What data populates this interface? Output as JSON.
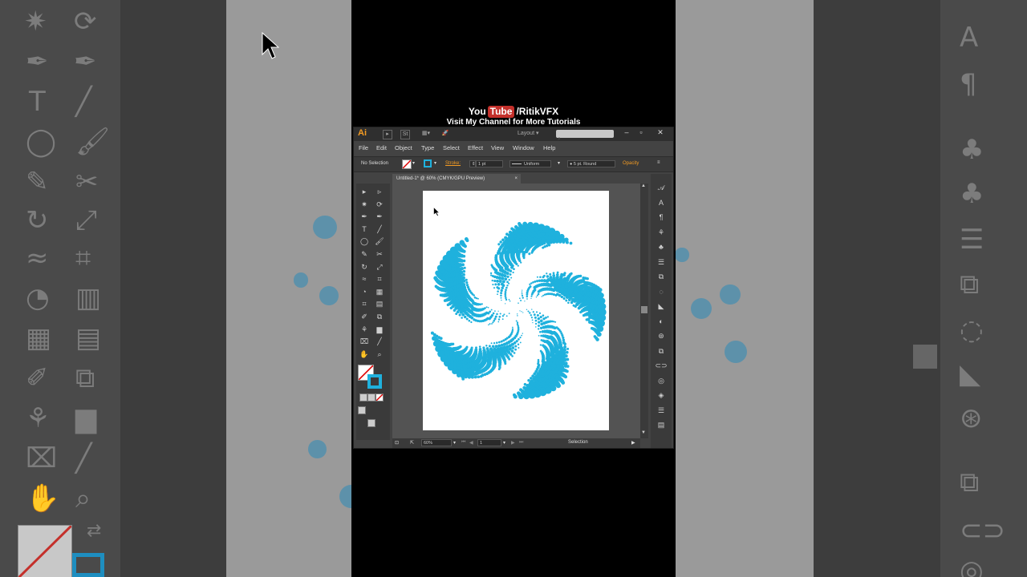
{
  "overlay": {
    "youtube_prefix": "You",
    "youtube_logo": "Tube",
    "channel": "/RitikVFX",
    "tagline": "Visit My Channel for More Tutorials"
  },
  "app": {
    "logo": "Ai",
    "workspace_label": "Layout",
    "menu": [
      "File",
      "Edit",
      "Object",
      "Type",
      "Select",
      "Effect",
      "View",
      "Window",
      "Help"
    ],
    "control_bar": {
      "selection_label": "No Selection",
      "stroke_label": "Stroke:",
      "stroke_value": "1 pt",
      "profile_value": "Uniform",
      "brush_value": "5 pt. Round",
      "opacity_label": "Opacity"
    },
    "document_tab": "Untitled-1* @ 60% (CMYK/GPU Preview)",
    "status": {
      "zoom": "60%",
      "artboard_number": "1",
      "tool_name": "Selection"
    }
  },
  "colors": {
    "accent": "#1fb1dd",
    "ai_brand": "#f39b23",
    "youtube_red": "#c4302b"
  },
  "icons": {
    "tools": [
      "selection-tool-icon",
      "direct-selection-tool-icon",
      "magic-wand-icon",
      "lasso-icon",
      "pen-tool-icon",
      "curvature-tool-icon",
      "type-tool-icon",
      "line-tool-icon",
      "ellipse-tool-icon",
      "paintbrush-icon",
      "pencil-icon",
      "scissors-icon",
      "rotate-tool-icon",
      "scale-tool-icon",
      "warp-tool-icon",
      "free-transform-icon",
      "shape-builder-icon",
      "perspective-grid-icon",
      "mesh-tool-icon",
      "gradient-tool-icon",
      "eyedropper-icon",
      "blend-tool-icon",
      "symbol-sprayer-icon",
      "graph-tool-icon",
      "artboard-tool-icon",
      "slice-tool-icon",
      "hand-tool-icon",
      "zoom-tool-icon"
    ],
    "panels": [
      "character-styles-icon",
      "character-icon",
      "paragraph-icon",
      "symbols-icon",
      "brushes-icon",
      "align-icon",
      "pathfinder-icon",
      "appearance-icon",
      "gradient-icon",
      "transparency-icon",
      "transform-icon",
      "links-icon",
      "color-guide-icon",
      "layers-icon",
      "properties-icon",
      "artboards-icon",
      "asset-export-icon"
    ]
  }
}
